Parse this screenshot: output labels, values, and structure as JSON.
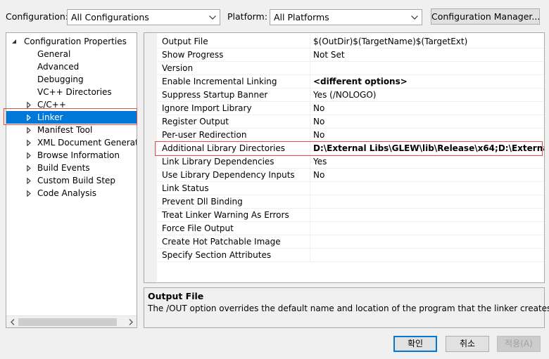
{
  "toolbar": {
    "configuration_label": "Configuration:",
    "configuration_value": "All Configurations",
    "platform_label": "Platform:",
    "platform_value": "All Platforms",
    "config_manager_label": "Configuration Manager..."
  },
  "tree": {
    "root": "Configuration Properties",
    "items": [
      {
        "label": "General",
        "expandable": false
      },
      {
        "label": "Advanced",
        "expandable": false
      },
      {
        "label": "Debugging",
        "expandable": false
      },
      {
        "label": "VC++ Directories",
        "expandable": false
      },
      {
        "label": "C/C++",
        "expandable": true
      },
      {
        "label": "Linker",
        "expandable": true,
        "selected": true
      },
      {
        "label": "Manifest Tool",
        "expandable": true
      },
      {
        "label": "XML Document Generator",
        "expandable": true
      },
      {
        "label": "Browse Information",
        "expandable": true
      },
      {
        "label": "Build Events",
        "expandable": true
      },
      {
        "label": "Custom Build Step",
        "expandable": true
      },
      {
        "label": "Code Analysis",
        "expandable": true
      }
    ]
  },
  "properties": [
    {
      "name": "Output File",
      "value": "$(OutDir)$(TargetName)$(TargetExt)",
      "bold": false
    },
    {
      "name": "Show Progress",
      "value": "Not Set",
      "bold": false
    },
    {
      "name": "Version",
      "value": "",
      "bold": false
    },
    {
      "name": "Enable Incremental Linking",
      "value": "<different options>",
      "bold": true
    },
    {
      "name": "Suppress Startup Banner",
      "value": "Yes (/NOLOGO)",
      "bold": false
    },
    {
      "name": "Ignore Import Library",
      "value": "No",
      "bold": false
    },
    {
      "name": "Register Output",
      "value": "No",
      "bold": false
    },
    {
      "name": "Per-user Redirection",
      "value": "No",
      "bold": false
    },
    {
      "name": "Additional Library Directories",
      "value": "D:\\External Libs\\GLEW\\lib\\Release\\x64;D:\\External Li",
      "bold": true
    },
    {
      "name": "Link Library Dependencies",
      "value": "Yes",
      "bold": false
    },
    {
      "name": "Use Library Dependency Inputs",
      "value": "No",
      "bold": false
    },
    {
      "name": "Link Status",
      "value": "",
      "bold": false
    },
    {
      "name": "Prevent Dll Binding",
      "value": "",
      "bold": false
    },
    {
      "name": "Treat Linker Warning As Errors",
      "value": "",
      "bold": false
    },
    {
      "name": "Force File Output",
      "value": "",
      "bold": false
    },
    {
      "name": "Create Hot Patchable Image",
      "value": "",
      "bold": false
    },
    {
      "name": "Specify Section Attributes",
      "value": "",
      "bold": false
    }
  ],
  "description": {
    "title": "Output File",
    "text": "The /OUT option overrides the default name and location of the program that the linker creates."
  },
  "buttons": {
    "ok": "확인",
    "cancel": "취소",
    "apply": "적용(A)"
  },
  "colors": {
    "selection": "#0078d7",
    "highlight_outline": "#e0504a"
  },
  "icons": {
    "combo_chevron": "chevron-down-icon",
    "tree_expanded": "triangle-down-icon",
    "tree_collapsed": "triangle-right-icon"
  }
}
